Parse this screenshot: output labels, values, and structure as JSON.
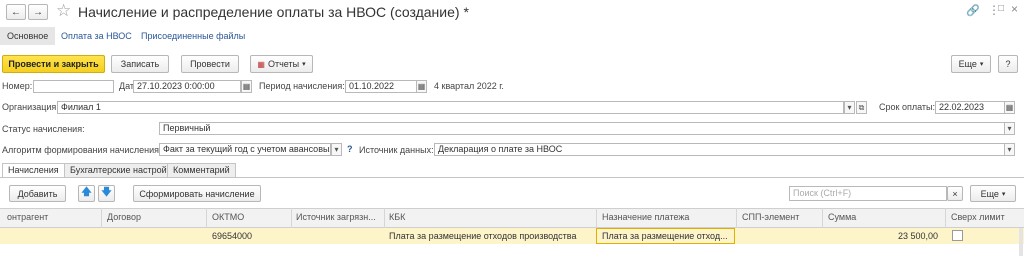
{
  "window": {
    "title": "Начисление и распределение оплаты за НВОС (создание) *"
  },
  "top_tabs": [
    {
      "label": "Основное"
    },
    {
      "label": "Оплата за НВОС"
    },
    {
      "label": "Присоединенные файлы"
    }
  ],
  "toolbar": {
    "post_close": "Провести и закрыть",
    "save": "Записать",
    "post": "Провести",
    "reports": "Отчеты",
    "more": "Еще",
    "help": "?"
  },
  "header_fields": {
    "number_label": "Номер:",
    "number_value": "",
    "date_label": "Дата:",
    "date_value": "27.10.2023  0:00:00",
    "period_label": "Период начисления:",
    "period_value": "01.10.2022",
    "quarter_text": "4 квартал 2022 г.",
    "org_label": "Организация:",
    "org_value": "Филиал 1",
    "due_label": "Срок оплаты:",
    "due_value": "22.02.2023",
    "status_label": "Статус начисления:",
    "status_value": "Первичный",
    "algo_label": "Алгоритм формирования начисления:",
    "algo_value": "Факт за текущий год с учетом авансовых",
    "source_label": "Источник данных:",
    "source_value": "Декларация о плате за НВОС"
  },
  "section_tabs": [
    {
      "label": "Начисления"
    },
    {
      "label": "Бухгалтерские настройки"
    },
    {
      "label": "Комментарий"
    }
  ],
  "table_toolbar": {
    "add": "Добавить",
    "generate": "Сформировать начисление",
    "search_placeholder": "Поиск (Ctrl+F)",
    "clear": "×",
    "more": "Еще"
  },
  "table": {
    "columns": [
      "онтрагент",
      "Договор",
      "ОКТМО",
      "Источник загрязн...",
      "КБК",
      "Назначение платежа",
      "СПП-элемент",
      "Сумма",
      "Сверх лимит"
    ],
    "rows": [
      {
        "counterparty": "",
        "contract": "",
        "oktmo": "69654000",
        "source": "",
        "kbk": "Плата за размещение отходов производства",
        "purpose": "Плата за размещение отход...",
        "spp": "",
        "amount": "23 500,00",
        "over_limit": false
      }
    ]
  },
  "colors": {
    "accent_yellow": "#f5cf1f",
    "row_highlight": "#fdf4c9",
    "link_blue": "#2b5797"
  }
}
